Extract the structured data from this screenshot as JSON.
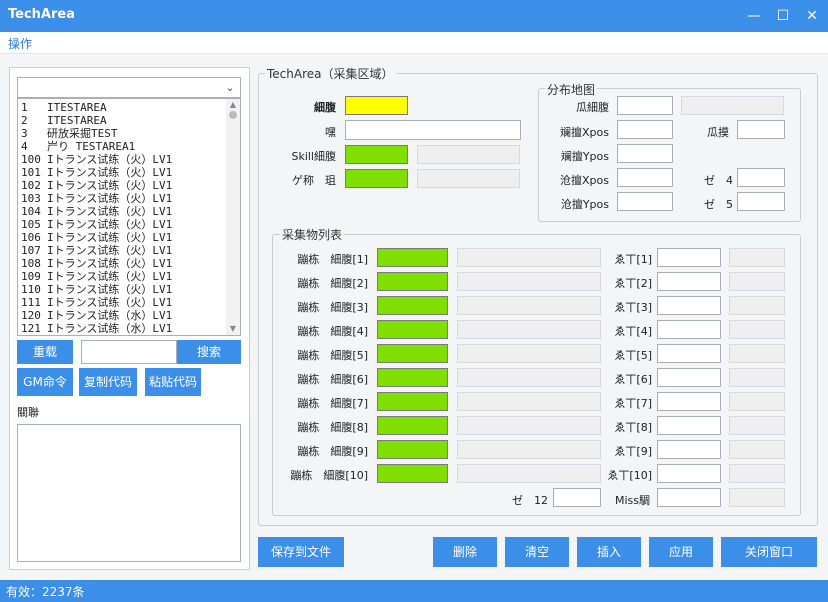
{
  "window": {
    "title": "TechArea",
    "minimize": "—",
    "maximize": "☐",
    "close": "✕"
  },
  "menu": {
    "operate": "操作"
  },
  "left": {
    "list_items": [
      {
        "idx": "1",
        "text": "ITESTAREA"
      },
      {
        "idx": "2",
        "text": "ITESTAREA"
      },
      {
        "idx": "3",
        "text": "研放采掘TEST"
      },
      {
        "idx": "4",
        "text": "屵り TESTAREA1"
      },
      {
        "idx": "100",
        "text": "Iトランス试练（火）LV1"
      },
      {
        "idx": "101",
        "text": "Iトランス试练（火）LV1"
      },
      {
        "idx": "102",
        "text": "Iトランス试练（火）LV1"
      },
      {
        "idx": "103",
        "text": "Iトランス试练（火）LV1"
      },
      {
        "idx": "104",
        "text": "Iトランス试练（火）LV1"
      },
      {
        "idx": "105",
        "text": "Iトランス试练（火）LV1"
      },
      {
        "idx": "106",
        "text": "Iトランス试练（火）LV1"
      },
      {
        "idx": "107",
        "text": "Iトランス试练（火）LV1"
      },
      {
        "idx": "108",
        "text": "Iトランス试练（火）LV1"
      },
      {
        "idx": "109",
        "text": "Iトランス试练（火）LV1"
      },
      {
        "idx": "110",
        "text": "Iトランス试练（火）LV1"
      },
      {
        "idx": "111",
        "text": "Iトランス试练（火）LV1"
      },
      {
        "idx": "120",
        "text": "Iトランス试练（水）LV1"
      },
      {
        "idx": "121",
        "text": "Iトランス试练（水）LV1"
      }
    ],
    "reload_btn": "重载",
    "search_btn": "搜索",
    "search_value": "",
    "gm_btn": "GM命令",
    "copy_btn": "复制代码",
    "paste_btn": "粘贴代码",
    "notes_label": "關聯"
  },
  "area": {
    "group_title": "TechArea（采集区域）",
    "fields": {
      "name": "細腹",
      "desc": "嘿",
      "skill": "Skill細腹",
      "kind": "ゲ称　珇"
    },
    "map": {
      "title": "分布地图",
      "f1": "瓜細腹",
      "f2": "斓擅Xpos",
      "f3": "瓜摸",
      "f4": "斓擅Ypos",
      "f5": "沧擅Xpos",
      "f6": "ゼ　4",
      "f7": "沧擅Ypos",
      "f8": "ゼ　5"
    }
  },
  "collect": {
    "title": "采集物列表",
    "rows": [
      {
        "label": "蹦栋　細腹[1]",
        "right": "ゑ丅[1]"
      },
      {
        "label": "蹦栋　細腹[2]",
        "right": "ゑ丅[2]"
      },
      {
        "label": "蹦栋　細腹[3]",
        "right": "ゑ丅[3]"
      },
      {
        "label": "蹦栋　細腹[4]",
        "right": "ゑ丅[4]"
      },
      {
        "label": "蹦栋　細腹[5]",
        "right": "ゑ丅[5]"
      },
      {
        "label": "蹦栋　細腹[6]",
        "right": "ゑ丅[6]"
      },
      {
        "label": "蹦栋　細腹[7]",
        "right": "ゑ丅[7]"
      },
      {
        "label": "蹦栋　細腹[8]",
        "right": "ゑ丅[8]"
      },
      {
        "label": "蹦栋　細腹[9]",
        "right": "ゑ丅[9]"
      },
      {
        "label": "蹦栋　細腹[10]",
        "right": "ゑ丅[10]"
      }
    ],
    "extra_label": "ゼ　12",
    "miss_label": "Miss騆"
  },
  "buttons": {
    "save": "保存到文件",
    "delete": "删除",
    "clear": "清空",
    "insert": "插入",
    "apply": "应用",
    "close": "关闭窗口"
  },
  "status": {
    "text": "有效：2237条"
  },
  "colors": {
    "accent": "#3c8fe8",
    "green": "#7fe000",
    "yellow": "#ffff00"
  }
}
